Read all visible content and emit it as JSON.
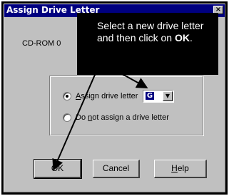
{
  "window": {
    "title": "Assign Drive Letter",
    "close_glyph": "×"
  },
  "device": {
    "label": "CD-ROM 0"
  },
  "options": {
    "assign_label_prefix": "",
    "assign_label_underline": "A",
    "assign_label_rest": "ssign drive letter",
    "assign_checked": true,
    "drive_letter": "G",
    "none_label_prefix": "Do ",
    "none_label_underline": "n",
    "none_label_rest": "ot assign a drive letter",
    "none_checked": false
  },
  "buttons": {
    "ok": "OK",
    "cancel": "Cancel",
    "help_underline": "H",
    "help_rest": "elp"
  },
  "callout": {
    "text_before": "Select a new drive letter and then click on ",
    "text_bold": "OK",
    "text_after": "."
  },
  "colors": {
    "title_bar": "#000080",
    "dialog_face": "#c0c0c0",
    "callout_bg": "#000000"
  }
}
